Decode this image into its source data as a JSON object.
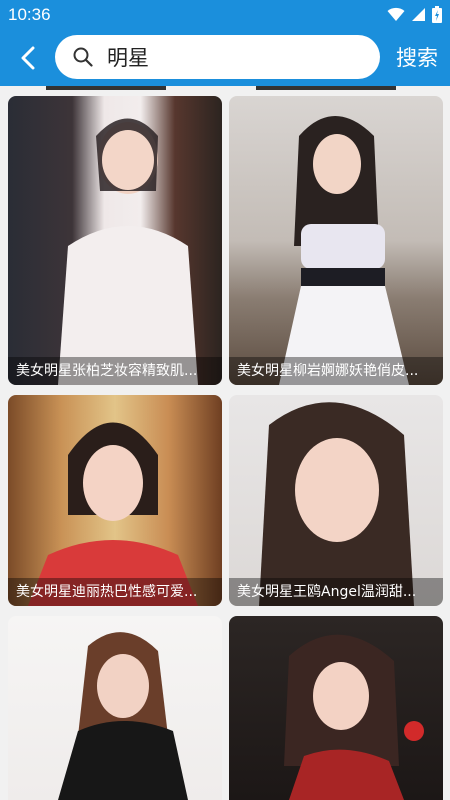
{
  "status": {
    "time": "10:36"
  },
  "search": {
    "query": "明星",
    "button_label": "搜索"
  },
  "cards": [
    {
      "caption": "美女明星张柏芝妆容精致肌..."
    },
    {
      "caption": "美女明星柳岩婀娜妖艳俏皮..."
    },
    {
      "caption": "美女明星迪丽热巴性感可爱..."
    },
    {
      "caption": "美女明星王鸥Angel温润甜..."
    },
    {
      "caption": ""
    },
    {
      "caption": ""
    }
  ],
  "icons": [
    "wifi-icon",
    "cellular-icon",
    "battery-icon",
    "back-arrow-icon",
    "search-icon"
  ],
  "colors": {
    "primary": "#1b8fdc",
    "background": "#f1f1f1"
  }
}
